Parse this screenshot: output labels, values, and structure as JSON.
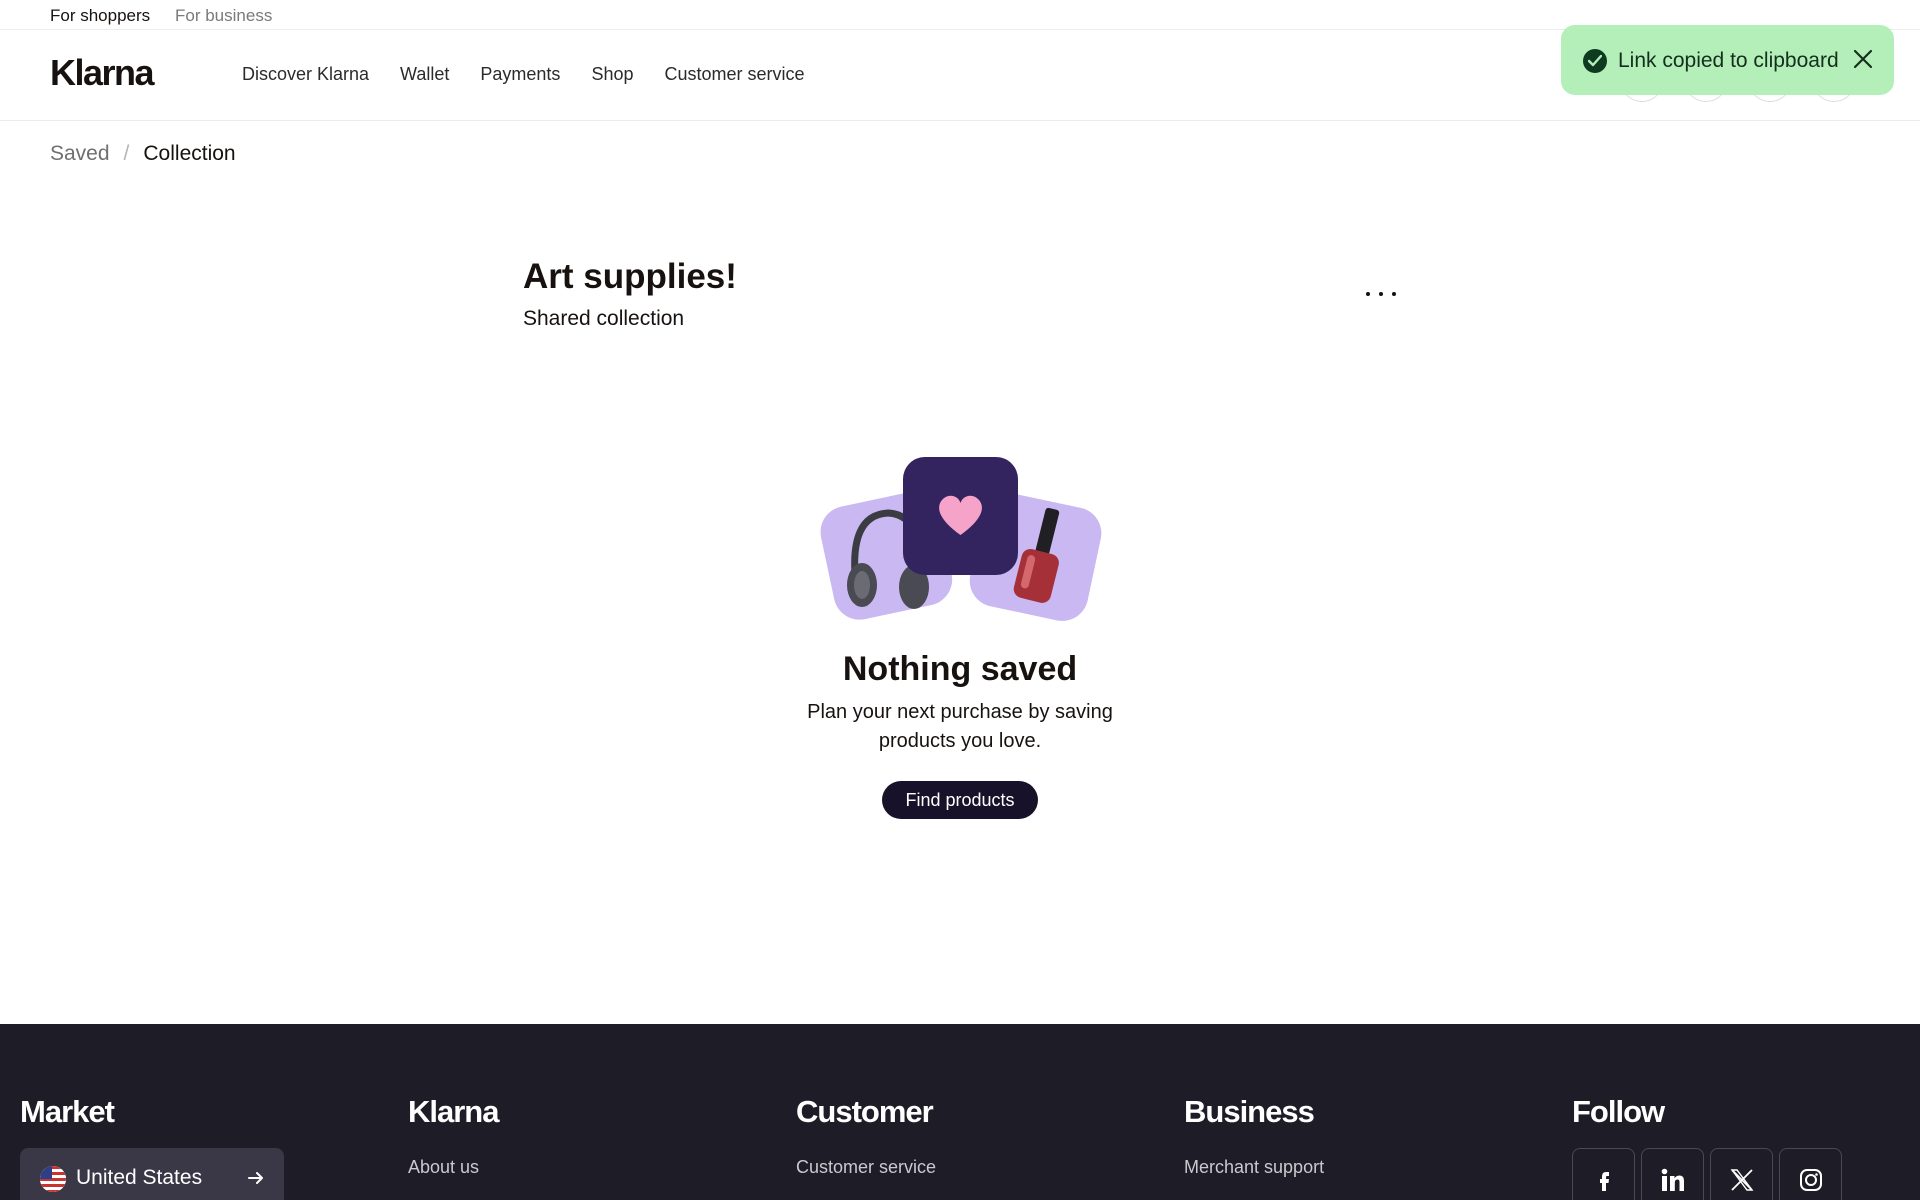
{
  "audience": {
    "shoppers": "For shoppers",
    "business": "For business"
  },
  "header": {
    "logo": "Klarna",
    "nav": [
      "Discover Klarna",
      "Wallet",
      "Payments",
      "Shop",
      "Customer service"
    ]
  },
  "toast": {
    "text": "Link copied to clipboard"
  },
  "breadcrumb": {
    "parent": "Saved",
    "separator": "/",
    "current": "Collection"
  },
  "collection": {
    "title": "Art supplies!",
    "subtitle": "Shared collection"
  },
  "empty_state": {
    "title": "Nothing saved",
    "description": "Plan your next purchase by saving products you love.",
    "button": "Find products"
  },
  "footer": {
    "market": {
      "heading": "Market",
      "country": "United States"
    },
    "klarna": {
      "heading": "Klarna",
      "link": "About us"
    },
    "customer": {
      "heading": "Customer",
      "link": "Customer service"
    },
    "business": {
      "heading": "Business",
      "link": "Merchant support"
    },
    "follow": {
      "heading": "Follow",
      "icons": [
        "facebook-icon",
        "linkedin-icon",
        "x-icon",
        "instagram-icon"
      ]
    }
  },
  "colors": {
    "toast_bg": "#b4efba",
    "footer_bg": "#1e1c27",
    "primary_button": "#17122a",
    "illustration_accent": "#c9b8f2"
  }
}
